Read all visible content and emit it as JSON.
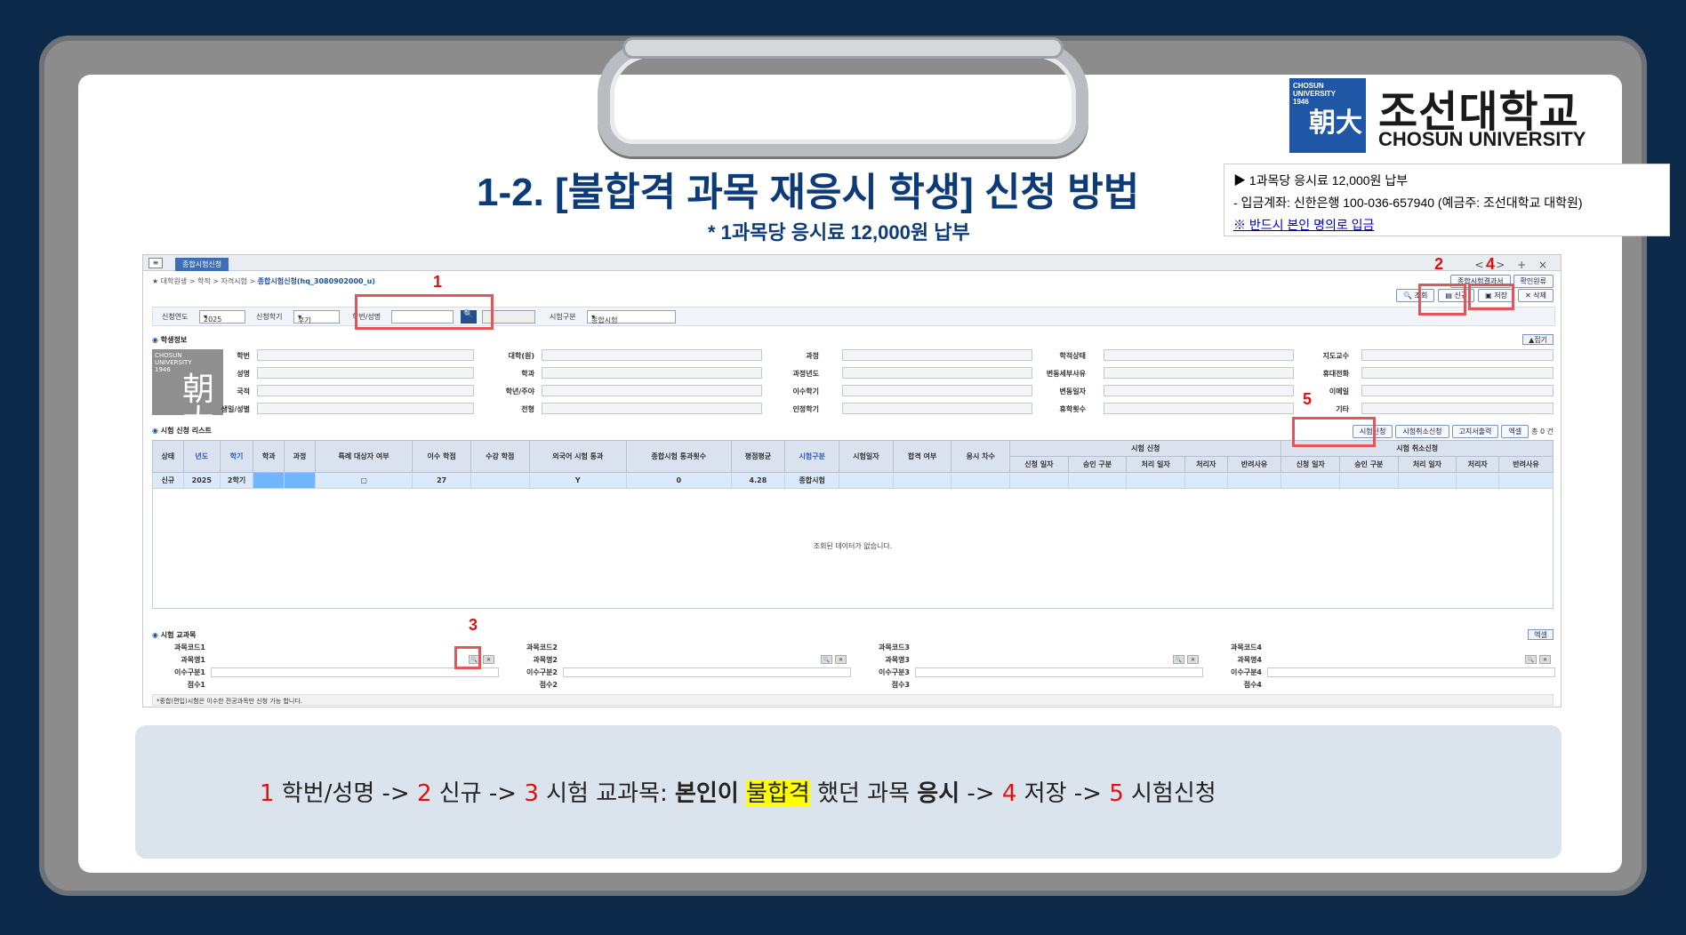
{
  "slide": {
    "title": "1-2. [불합격 과목 재응시 학생] 신청 방법",
    "subtitle": "* 1과목당 응시료 12,000원 납부",
    "logo": {
      "box_text_1": "CHOSUN",
      "box_text_2": "UNIVERSITY",
      "box_text_3": "1946",
      "seal": "朝大",
      "ko": "조선대학교",
      "en": "CHOSUN UNIVERSITY",
      "brand_color": "#1f56a5"
    },
    "notice": {
      "line1": "▶ 1과목당 응시료 12,000원 납부",
      "line2": "- 입금계좌: 신한은행 100-036-657940 (예금주: 조선대학교 대학원)",
      "line3": "※ 반드시 본인 명의로 입금"
    }
  },
  "app": {
    "tab_label": "종합시험신청",
    "breadcrumb_path": "대학원생 > 학적 > 자격시험 > ",
    "breadcrumb_current": "종합시험신청(hq_3080902000_u)",
    "window_controls": "< > + ×",
    "mini_buttons": [
      "종합시험결과서",
      "확인원류"
    ],
    "toolbar": {
      "search": "조회",
      "new": "신규",
      "save": "저장",
      "delete": "삭제"
    },
    "condition": {
      "year_label": "신청연도",
      "year_value": "2025",
      "term_label": "신청학기",
      "term_value": "후기",
      "student_label": "학번/성명",
      "student_value": "",
      "search_btn": "🔍",
      "exam_type_label": "시험구분",
      "exam_type_value": "종합시험"
    },
    "student_section": {
      "title": "학생정보",
      "fold": "▲접기",
      "photo_text_1": "CHOSUN",
      "photo_text_2": "UNIVERSITY",
      "photo_text_3": "1946",
      "col1": [
        "학번",
        "성명",
        "국적",
        "생일/성별"
      ],
      "col2": [
        "대학(원)",
        "학과",
        "학년/주야",
        "전형"
      ],
      "col3": [
        "과정",
        "과정년도",
        "이수학기",
        "인정학기"
      ],
      "col4": [
        "학적상태",
        "변동세부사유",
        "변동일자",
        "휴학횟수"
      ],
      "col5": [
        "지도교수",
        "휴대전화",
        "이메일",
        "기타"
      ]
    },
    "exam_list": {
      "title": "시험 신청 리스트",
      "buttons": [
        "시험신청",
        "시험취소신청",
        "고지서출력",
        "엑셀"
      ],
      "count": "총 0 건",
      "headers": [
        "상태",
        "년도",
        "학기",
        "학과",
        "과정",
        "특례 대상자 여부",
        "이수 학점",
        "수강 학점",
        "외국어 시험 통과",
        "종합시험 통과횟수",
        "평점평균",
        "시험구분",
        "시험일자",
        "합격 여부",
        "응시 차수"
      ],
      "group_apply": "시험 신청",
      "apply_headers": [
        "신청 일자",
        "승인 구분",
        "처리 일자",
        "처리자",
        "반려사유"
      ],
      "group_cancel": "시험 취소신청",
      "cancel_headers": [
        "신청 일자",
        "승인 구분",
        "처리 일자",
        "처리자",
        "반려사유"
      ],
      "row": {
        "status": "신규",
        "year": "2025",
        "term": "2학기",
        "credits": "27",
        "lang": "Y",
        "pass_count": "0",
        "gpa": "4.28",
        "exam_type": "종합시험"
      },
      "empty_message": "조회된 데이터가 없습니다."
    },
    "subjects": {
      "title": "시험 교과목",
      "excel": "엑셀",
      "code_labels": [
        "과목코드1",
        "과목코드2",
        "과목코드3",
        "과목코드4"
      ],
      "name_labels": [
        "과목명1",
        "과목명2",
        "과목명3",
        "과목명4"
      ],
      "type_labels": [
        "이수구분1",
        "이수구분2",
        "이수구분3",
        "이수구분4"
      ],
      "score_labels": [
        "점수1",
        "점수2",
        "점수3",
        "점수4"
      ],
      "footnote": "*종합(편입)시험은 이수한 전공과목만 신청 가능 합니다."
    }
  },
  "markers": [
    "1",
    "2",
    "3",
    "4",
    "5"
  ],
  "instruction": {
    "n1": "1",
    "s1": " 학번/성명 -> ",
    "n2": "2",
    "s2": " 신규 -> ",
    "n3": "3",
    "s3": " 시험 교과목: ",
    "b1": "본인이",
    "hl": "불합격",
    "s4": " 했던 과목 ",
    "b2": "응시",
    "s5": " -> ",
    "n4": "4",
    "s6": " 저장 -> ",
    "n5": "5",
    "s7": " 시험신청"
  }
}
